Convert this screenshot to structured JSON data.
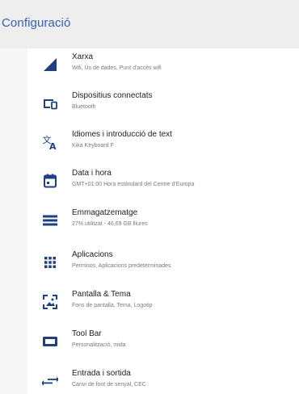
{
  "header": {
    "title": "Configuració"
  },
  "colors": {
    "accent": "#2f63b8",
    "icon": "#1e3f80",
    "title_text": "#212121",
    "subtitle_text": "#7a7a7a"
  },
  "items": [
    {
      "icon": "signal-icon",
      "title": "Xarxa",
      "subtitle": "Wifi, Ús de dades, Punt d'accés wifi"
    },
    {
      "icon": "devices-icon",
      "title": "Dispositius connectats",
      "subtitle": "Bluetooth"
    },
    {
      "icon": "translate-icon",
      "title": "Idiomes i introducció de text",
      "subtitle": "Kika Keyboard F"
    },
    {
      "icon": "calendar-icon",
      "title": "Data i hora",
      "subtitle": "GMT+01:00 Hora estàndard del Centre d'Europa"
    },
    {
      "icon": "storage-icon",
      "title": "Emmagatzematge",
      "subtitle": "27% utilitzat - 46,69 GB lliures"
    },
    {
      "icon": "apps-grid-icon",
      "title": "Aplicacions",
      "subtitle": "Permisos, Aplicacions predeterminades"
    },
    {
      "icon": "wallpaper-icon",
      "title": "Pantalla & Tema",
      "subtitle": "Fons de pantalla, Tema, Logotip"
    },
    {
      "icon": "toolbar-icon",
      "title": "Tool Bar",
      "subtitle": "Personalització, mida"
    },
    {
      "icon": "input-output-icon",
      "title": "Entrada i sortida",
      "subtitle": "Canvi de font de senyal, CEC"
    }
  ]
}
